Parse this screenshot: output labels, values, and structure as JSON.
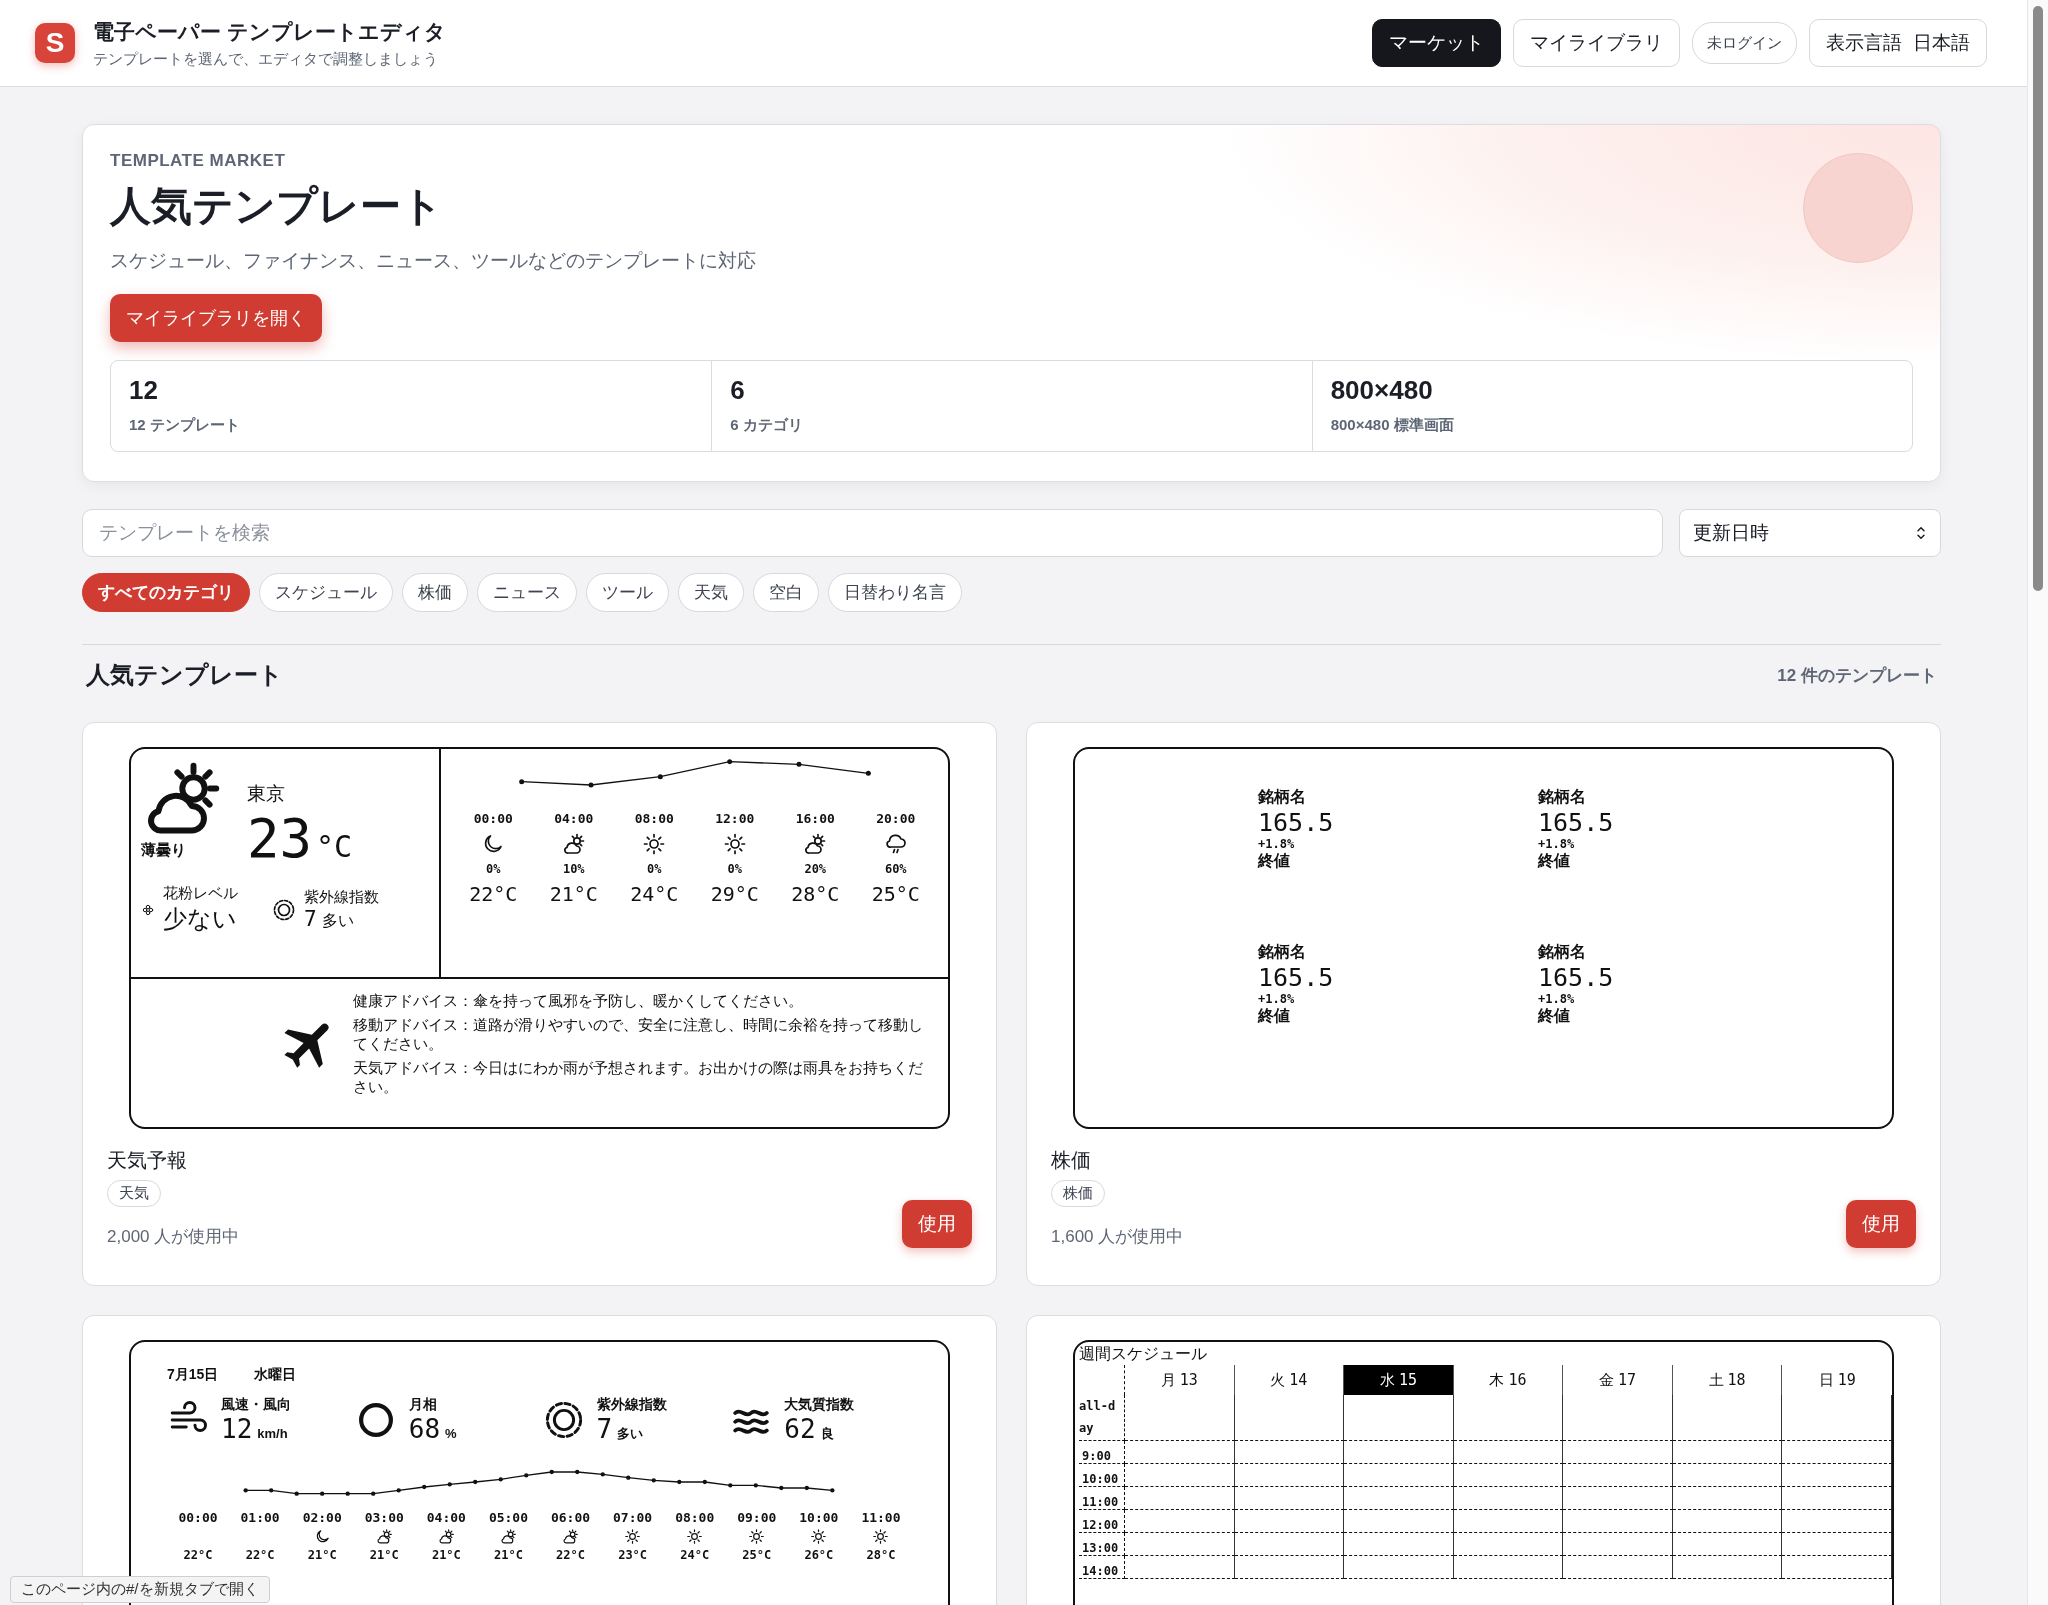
{
  "header": {
    "logo": "S",
    "title": "電子ペーパー テンプレートエディタ",
    "subtitle": "テンプレートを選んで、エディタで調整しましょう",
    "nav": [
      {
        "label": "マーケット",
        "selected": true
      },
      {
        "label": "マイライブラリ",
        "selected": false
      }
    ],
    "login_status": "未ログイン",
    "language": {
      "label": "表示言語",
      "value": "日本語"
    }
  },
  "hero": {
    "eyebrow": "TEMPLATE MARKET",
    "title": "人気テンプレート",
    "description": "スケジュール、ファイナンス、ニュース、ツールなどのテンプレートに対応",
    "cta": "マイライブラリを開く",
    "stats": [
      {
        "value": "12",
        "label": "12 テンプレート"
      },
      {
        "value": "6",
        "label": "6 カテゴリ"
      },
      {
        "value": "800×480",
        "label": "800×480 標準画面"
      }
    ]
  },
  "search": {
    "placeholder": "テンプレートを検索"
  },
  "sort": {
    "value": "更新日時"
  },
  "categories": [
    {
      "label": "すべてのカテゴリ",
      "selected": true
    },
    {
      "label": "スケジュール",
      "selected": false
    },
    {
      "label": "株価",
      "selected": false
    },
    {
      "label": "ニュース",
      "selected": false
    },
    {
      "label": "ツール",
      "selected": false
    },
    {
      "label": "天気",
      "selected": false
    },
    {
      "label": "空白",
      "selected": false
    },
    {
      "label": "日替わり名言",
      "selected": false
    }
  ],
  "section": {
    "title": "人気テンプレート",
    "count": "12 件のテンプレート"
  },
  "templates": [
    {
      "kind": "weather",
      "name": "天気予報",
      "tag": "天気",
      "users": "2,000 人が使用中",
      "action": "使用",
      "preview": {
        "city": "東京",
        "temp": "23",
        "unit": "°C",
        "condition": "薄曇り",
        "pollen": {
          "label": "花粉レベル",
          "value": "少ない"
        },
        "uv": {
          "label": "紫外線指数",
          "value": "7",
          "note": "多い"
        },
        "hourly": [
          {
            "time": "00:00",
            "kind": "moon",
            "precip": "0%",
            "temp": "22°C"
          },
          {
            "time": "04:00",
            "kind": "partly",
            "precip": "10%",
            "temp": "21°C"
          },
          {
            "time": "08:00",
            "kind": "sun",
            "precip": "0%",
            "temp": "24°C"
          },
          {
            "time": "12:00",
            "kind": "sun",
            "precip": "0%",
            "temp": "29°C"
          },
          {
            "time": "16:00",
            "kind": "partly",
            "precip": "20%",
            "temp": "28°C"
          },
          {
            "time": "20:00",
            "kind": "rain",
            "precip": "60%",
            "temp": "25°C"
          }
        ],
        "advice": [
          "健康アドバイス：傘を持って風邪を予防し、暖かくしてください。",
          "移動アドバイス：道路が滑りやすいので、安全に注意し、時間に余裕を持って移動してください。",
          "天気アドバイス：今日はにわか雨が予想されます。お出かけの際は雨具をお持ちください。"
        ]
      }
    },
    {
      "kind": "stocks",
      "name": "株価",
      "tag": "株価",
      "users": "1,600 人が使用中",
      "action": "使用",
      "preview": {
        "quotes": [
          {
            "name": "銘柄名",
            "price": "165.5",
            "change": "+1.8%",
            "note": "終値"
          },
          {
            "name": "銘柄名",
            "price": "165.5",
            "change": "+1.8%",
            "note": "終値"
          },
          {
            "name": "銘柄名",
            "price": "165.5",
            "change": "+1.8%",
            "note": "終値"
          },
          {
            "name": "銘柄名",
            "price": "165.5",
            "change": "+1.8%",
            "note": "終値"
          }
        ]
      }
    },
    {
      "kind": "weather_detail",
      "preview": {
        "date": "7月15日",
        "weekday": "水曜日",
        "metrics": [
          {
            "kind": "wind",
            "label": "風速・風向",
            "value": "12",
            "unit": "km/h"
          },
          {
            "kind": "circle",
            "label": "月相",
            "value": "68",
            "unit": "%"
          },
          {
            "kind": "uv",
            "label": "紫外線指数",
            "value": "7",
            "unit": "多い"
          },
          {
            "kind": "waves",
            "label": "大気質指数",
            "value": "62",
            "unit": "良"
          }
        ],
        "hourly": [
          {
            "time": "00:00",
            "temp": "22°C"
          },
          {
            "time": "01:00",
            "temp": "22°C"
          },
          {
            "time": "02:00",
            "kind": "moon",
            "temp": "21°C"
          },
          {
            "time": "03:00",
            "kind": "partly",
            "temp": "21°C"
          },
          {
            "time": "04:00",
            "kind": "partly",
            "temp": "21°C"
          },
          {
            "time": "05:00",
            "kind": "partly",
            "temp": "21°C"
          },
          {
            "time": "06:00",
            "kind": "partly",
            "temp": "22°C"
          },
          {
            "time": "07:00",
            "kind": "sun",
            "temp": "23°C"
          },
          {
            "time": "08:00",
            "kind": "sun",
            "temp": "24°C"
          },
          {
            "time": "09:00",
            "kind": "sun",
            "temp": "25°C"
          },
          {
            "time": "10:00",
            "kind": "sun",
            "temp": "26°C"
          },
          {
            "time": "11:00",
            "kind": "sun",
            "temp": "28°C"
          }
        ]
      }
    },
    {
      "kind": "week_schedule",
      "preview": {
        "title": "週間スケジュール",
        "all_day": "all-day",
        "days": [
          {
            "label": "月",
            "date": "13",
            "selected": false
          },
          {
            "label": "火",
            "date": "14",
            "selected": false
          },
          {
            "label": "水",
            "date": "15",
            "selected": true
          },
          {
            "label": "木",
            "date": "16",
            "selected": false
          },
          {
            "label": "金",
            "date": "17",
            "selected": false
          },
          {
            "label": "土",
            "date": "18",
            "selected": false
          },
          {
            "label": "日",
            "date": "19",
            "selected": false
          }
        ],
        "times": [
          "9:00",
          "10:00",
          "11:00",
          "12:00",
          "13:00",
          "14:00"
        ]
      }
    }
  ],
  "link_tooltip": "このページ内の#/を新規タブで開く"
}
